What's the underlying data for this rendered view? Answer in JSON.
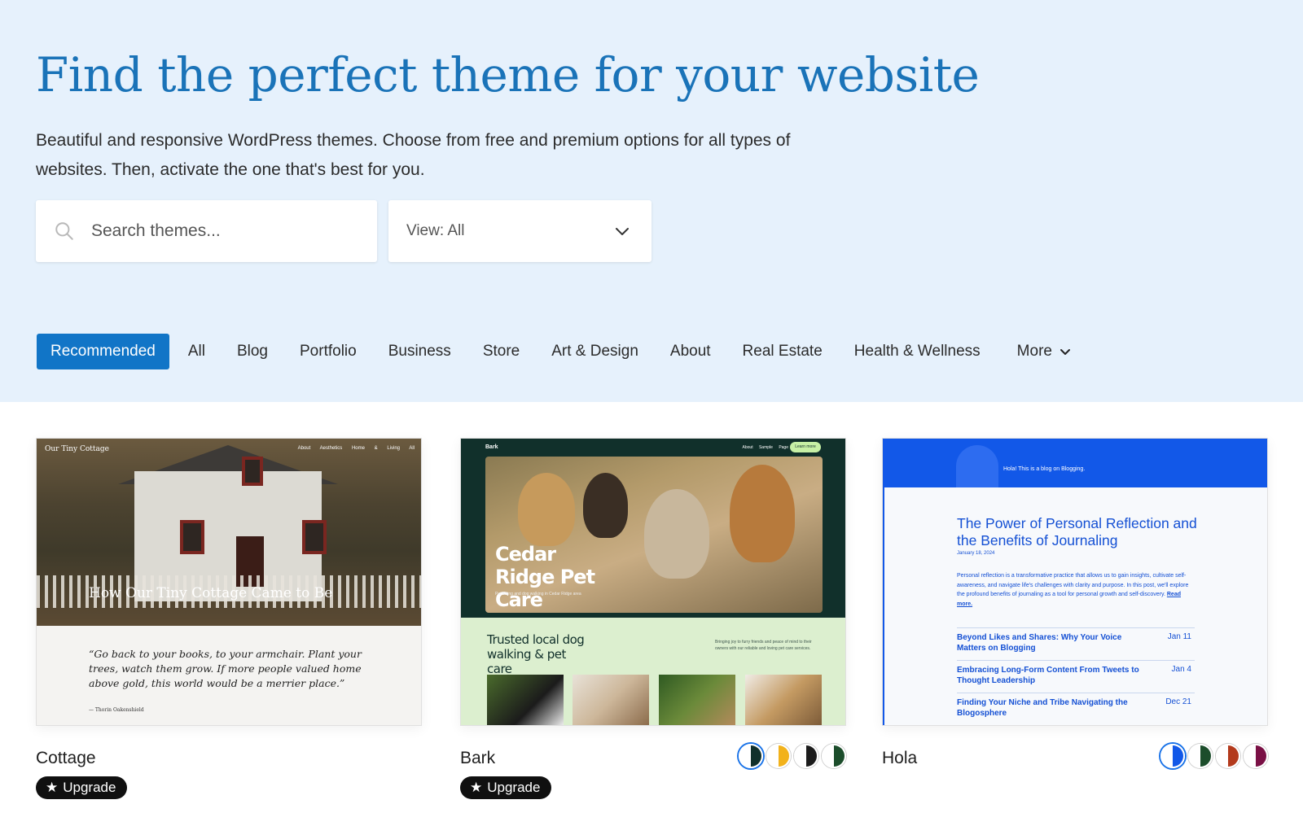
{
  "hero": {
    "title": "Find the perfect theme for your website",
    "subtitle": "Beautiful and responsive WordPress themes. Choose from free and premium options for all types of websites. Then, activate the one that's best for you."
  },
  "search": {
    "placeholder": "Search themes...",
    "icon": "search-icon"
  },
  "view_filter": {
    "label": "View: All",
    "icon": "chevron-down-icon"
  },
  "categories": {
    "items": [
      "Recommended",
      "All",
      "Blog",
      "Portfolio",
      "Business",
      "Store",
      "Art & Design",
      "About",
      "Real Estate",
      "Health & Wellness"
    ],
    "active": "Recommended",
    "more_label": "More",
    "active_color": "#1175c7"
  },
  "themes": [
    {
      "name": "Cottage",
      "badge": "Upgrade",
      "badge_icon": "star-icon",
      "preview": {
        "site_title": "Our Tiny Cottage",
        "nav": "About   Aesthetics   Home & Living   All",
        "headline": "How Our Tiny Cottage Came to Be",
        "quote": "“Go back to your books, to your armchair. Plant your trees, watch them grow. If more people valued home above gold, this world would be a merrier place.”",
        "quote_author": "— Thorin Oakenshield"
      }
    },
    {
      "name": "Bark",
      "badge": "Upgrade",
      "badge_icon": "star-icon",
      "preview": {
        "logo": "Bark",
        "nav": "About   Sample Page",
        "nav_button": "Learn more",
        "headline": "Cedar Ridge Pet Care",
        "caption": "Pet sitting and dog walking in Cedar Ridge area",
        "tagline": "Trusted local dog walking & pet care",
        "blurb": "Bringing joy to furry friends and peace of mind to their owners with our reliable and loving pet care services."
      },
      "styles": [
        {
          "left": "#ffffff",
          "right": "#11302b",
          "selected": true
        },
        {
          "left": "#ffffff",
          "right": "#f2b21b",
          "selected": false
        },
        {
          "left": "#ffffff",
          "right": "#1c1c1c",
          "selected": false
        },
        {
          "left": "#ffffff",
          "right": "#1c4d2b",
          "selected": false
        }
      ]
    },
    {
      "name": "Hola",
      "preview": {
        "hi": "Hola!   This is a blog on Blogging.",
        "headline": "The Power of Personal Reflection and the Benefits of Journaling",
        "date": "January 18, 2024",
        "excerpt": "Personal reflection is a transformative practice that allows us to gain insights, cultivate self-awareness, and navigate life's challenges with clarity and purpose. In this post, we'll explore the profound benefits of journaling as a tool for personal growth and self-discovery.",
        "read_more": "Read more.",
        "posts": [
          {
            "title": "Beyond Likes and Shares: Why Your Voice Matters on Blogging",
            "date": "Jan 11"
          },
          {
            "title": "Embracing Long-Form Content From Tweets to Thought Leadership",
            "date": "Jan 4"
          },
          {
            "title": "Finding Your Niche and Tribe Navigating the Blogosphere",
            "date": "Dec 21"
          }
        ]
      },
      "styles": [
        {
          "left": "#ffffff",
          "right": "#1258e8",
          "selected": true
        },
        {
          "left": "#ffffff",
          "right": "#1c4d2b",
          "selected": false
        },
        {
          "left": "#ffffff",
          "right": "#b33a1c",
          "selected": false
        },
        {
          "left": "#ffffff",
          "right": "#7a1045",
          "selected": false
        }
      ]
    }
  ]
}
